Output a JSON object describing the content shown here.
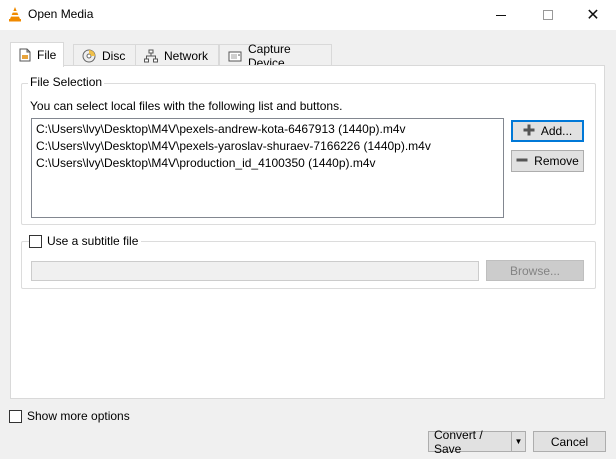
{
  "window": {
    "title": "Open Media",
    "icon": "vlc-cone-icon",
    "minimize_icon": "minimize-icon",
    "maximize_icon": "maximize-icon",
    "close_icon": "close-icon"
  },
  "tabs": [
    {
      "label": "File",
      "icon": "file-icon",
      "active": true
    },
    {
      "label": "Disc",
      "icon": "disc-icon",
      "active": false
    },
    {
      "label": "Network",
      "icon": "network-icon",
      "active": false
    },
    {
      "label": "Capture Device",
      "icon": "capture-device-icon",
      "active": false
    }
  ],
  "file_selection": {
    "legend": "File Selection",
    "helper": "You can select local files with the following list and buttons.",
    "files": [
      "C:\\Users\\lvy\\Desktop\\M4V\\pexels-andrew-kota-6467913 (1440p).m4v",
      "C:\\Users\\lvy\\Desktop\\M4V\\pexels-yaroslav-shuraev-7166226 (1440p).m4v",
      "C:\\Users\\lvy\\Desktop\\M4V\\production_id_4100350 (1440p).m4v"
    ],
    "add_label": "Add...",
    "remove_label": "Remove"
  },
  "subtitle": {
    "checkbox_label": "Use a subtitle file",
    "checked": false,
    "path_value": "",
    "browse_label": "Browse..."
  },
  "footer": {
    "more_options_label": "Show more options",
    "more_options_checked": false,
    "convert_label": "Convert / Save",
    "cancel_label": "Cancel"
  },
  "colors": {
    "focus": "#0078d7",
    "button_bg": "#e1e1e1",
    "vlc_orange": "#f08a00"
  }
}
